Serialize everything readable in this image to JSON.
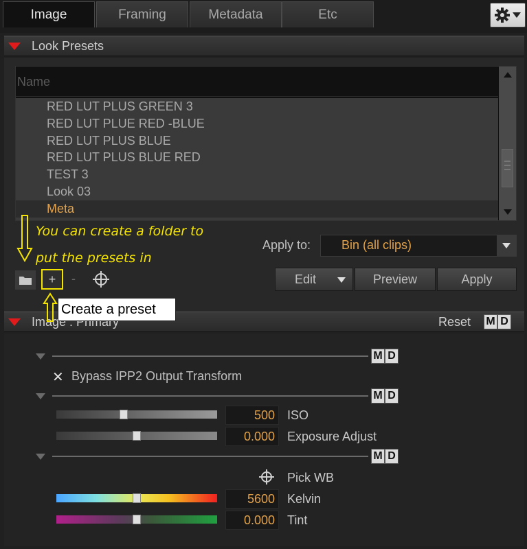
{
  "tabs": [
    {
      "label": "Image",
      "active": true
    },
    {
      "label": "Framing",
      "active": false
    },
    {
      "label": "Metadata",
      "active": false
    },
    {
      "label": "Etc",
      "active": false
    }
  ],
  "look_presets": {
    "title": "Look Presets",
    "list_header": "Name",
    "items": [
      "RED LUT PLUS GREEN 3",
      "RED LUT PLUE RED -BLUE",
      "RED LUT PLUS BLUE",
      "RED LUT PLUS BLUE RED",
      "TEST 3",
      "Look 03",
      "Meta"
    ],
    "selected_index": 6,
    "apply_to_label": "Apply to:",
    "apply_to_value": "Bin (all clips)",
    "plus_label": "+",
    "minus_label": "-",
    "edit_label": "Edit",
    "preview_label": "Preview",
    "apply_label": "Apply"
  },
  "annotations": {
    "folder_note_line1": "You can create a folder to",
    "folder_note_line2": "put the presets in",
    "tooltip": "Create a preset"
  },
  "image_section": {
    "title_visible": "Image : Primary",
    "reset_label": "Reset",
    "m_label": "M",
    "d_label": "D",
    "bypass_label": "Bypass IPP2 Output Transform",
    "iso_value": "500",
    "iso_label": "ISO",
    "iso_fraction": 0.42,
    "exposure_value": "0.000",
    "exposure_label": "Exposure Adjust",
    "exposure_fraction": 0.5,
    "pickwb_label": "Pick WB",
    "kelvin_value": "5600",
    "kelvin_label": "Kelvin",
    "kelvin_fraction": 0.5,
    "tint_value": "0.000",
    "tint_label": "Tint",
    "tint_fraction": 0.5
  },
  "colors": {
    "accent_orange": "#e2a24a",
    "annotation_yellow": "#f5e400",
    "collapse_red": "#e11b1b"
  }
}
